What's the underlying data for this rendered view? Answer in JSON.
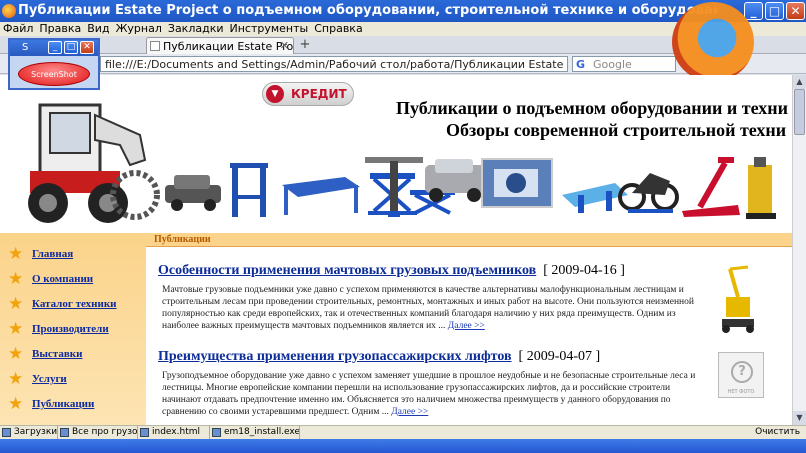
{
  "window": {
    "title": "Публикации Estate Project о подъемном оборудовании, строительной технике и оборудовании. Обзоры, ан..."
  },
  "menu": [
    "Файл",
    "Правка",
    "Вид",
    "Журнал",
    "Закладки",
    "Инструменты",
    "Справка"
  ],
  "tab": {
    "label": "Публикации Estate Project..."
  },
  "nav": {
    "url": "file:///E:/Documents and Settings/Admin/Рабочий стол/работа/Публикации Estate Project о подъемн",
    "search_placeholder": "Google",
    "search_logo": "G"
  },
  "screenshot_app": {
    "title": "S",
    "button": "ScreenShot"
  },
  "banner": {
    "credit": "КРЕДИТ",
    "line1": "Публикации о подъемном оборудовании и техни",
    "line2": "Обзоры современной строительной техни"
  },
  "section": {
    "title": "Публикации"
  },
  "leftnav": [
    "Главная",
    "О компании",
    "Каталог техники",
    "Производители",
    "Выставки",
    "Услуги",
    "Публикации"
  ],
  "articles": [
    {
      "title": "Особенности применения мачтовых грузовых подъемников",
      "date": "[ 2009-04-16 ]",
      "text": "Мачтовые грузовые подъемники уже давно с успехом применяются в качестве альтернативы малофункциональным лестницам и строительным лесам при проведении строительных, ремонтных, монтажных и иных работ на высоте. Они пользуются неизменной популярностью как среди европейских, так и отечественных компаний благодаря наличию у них ряда преимуществ. Одним из наиболее важных преимуществ мачтовых подъемников является их ...",
      "more": "Далее >>"
    },
    {
      "title": "Преимущества применения грузопассажирских лифтов",
      "date": "[ 2009-04-07 ]",
      "text": "Грузоподъемное оборудование уже давно с успехом заменяет ушедшие в прошлое неудобные и не безопасные строительные леса и лестницы. Многие европейские компании перешли на использование грузопассажирских лифтов, да и российские строители начинают отдавать предпочтение именно им. Объясняется это наличием множества преимуществ у данного оборудования по сравнению со своими устаревшими предшест. Одним ...",
      "more": "Далее >>"
    }
  ],
  "no_image": {
    "label": "НЕТ ФОТО",
    "glyph": "?"
  },
  "status": {
    "right": "Очистить"
  },
  "taskbar": [
    "Загрузки",
    "Все про грузовы",
    "index.html",
    "em18_install.exe"
  ],
  "icons": [
    "firefox-icon",
    "minimize-icon",
    "maximize-icon",
    "close-icon",
    "star-icon",
    "excavator-image",
    "no-photo-icon"
  ]
}
